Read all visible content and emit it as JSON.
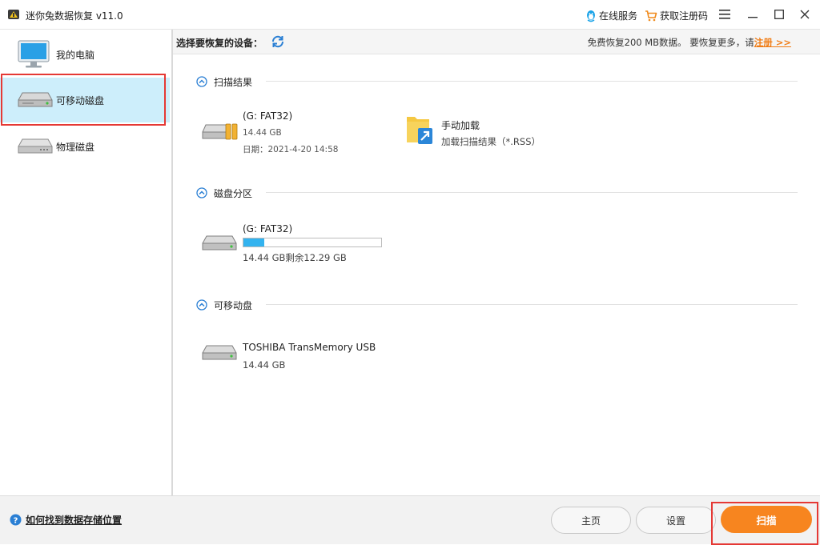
{
  "window": {
    "title": "迷你兔数据恢复 v11.0"
  },
  "titlebar": {
    "online_service": "在线服务",
    "get_code": "获取注册码",
    "menu_icon": "hamburger-icon",
    "minimize_icon": "minimize-icon",
    "maximize_icon": "maximize-icon",
    "close_icon": "close-icon"
  },
  "sidebar": {
    "items": [
      {
        "label": "我的电脑",
        "icon": "monitor-icon"
      },
      {
        "label": "可移动磁盘",
        "icon": "removable-drive-icon",
        "active": true
      },
      {
        "label": "物理磁盘",
        "icon": "physical-disk-icon"
      }
    ]
  },
  "topbar": {
    "device_label": "选择要恢复的设备：",
    "promo_text": "免费恢复200 MB数据。 要恢复更多，请",
    "promo_link": "注册 >>"
  },
  "sections": {
    "scan_results": {
      "title": "扫描结果",
      "item": {
        "name": "(G: FAT32)",
        "size": "14.44 GB",
        "date": "日期：2021-4-20 14:58"
      },
      "manual": {
        "title": "手动加载",
        "subtitle": "加载扫描结果（*.RSS）"
      }
    },
    "partitions": {
      "title": "磁盘分区",
      "item": {
        "name": "(G: FAT32)",
        "usage": "14.44 GB剩余12.29 GB",
        "used_fraction": 0.15
      }
    },
    "removable": {
      "title": "可移动盘",
      "item": {
        "name": "TOSHIBA TransMemory USB",
        "size": "14.44 GB"
      }
    }
  },
  "bottom": {
    "help_text": "如何找到数据存储位置",
    "home_label": "主页",
    "settings_label": "设置",
    "scan_label": "扫描"
  },
  "colors": {
    "accent_orange": "#f7851f",
    "active_bg": "#cdeefb",
    "progress_blue": "#33b3ef",
    "highlight_red": "#e53935",
    "link_orange": "#f07c14"
  }
}
